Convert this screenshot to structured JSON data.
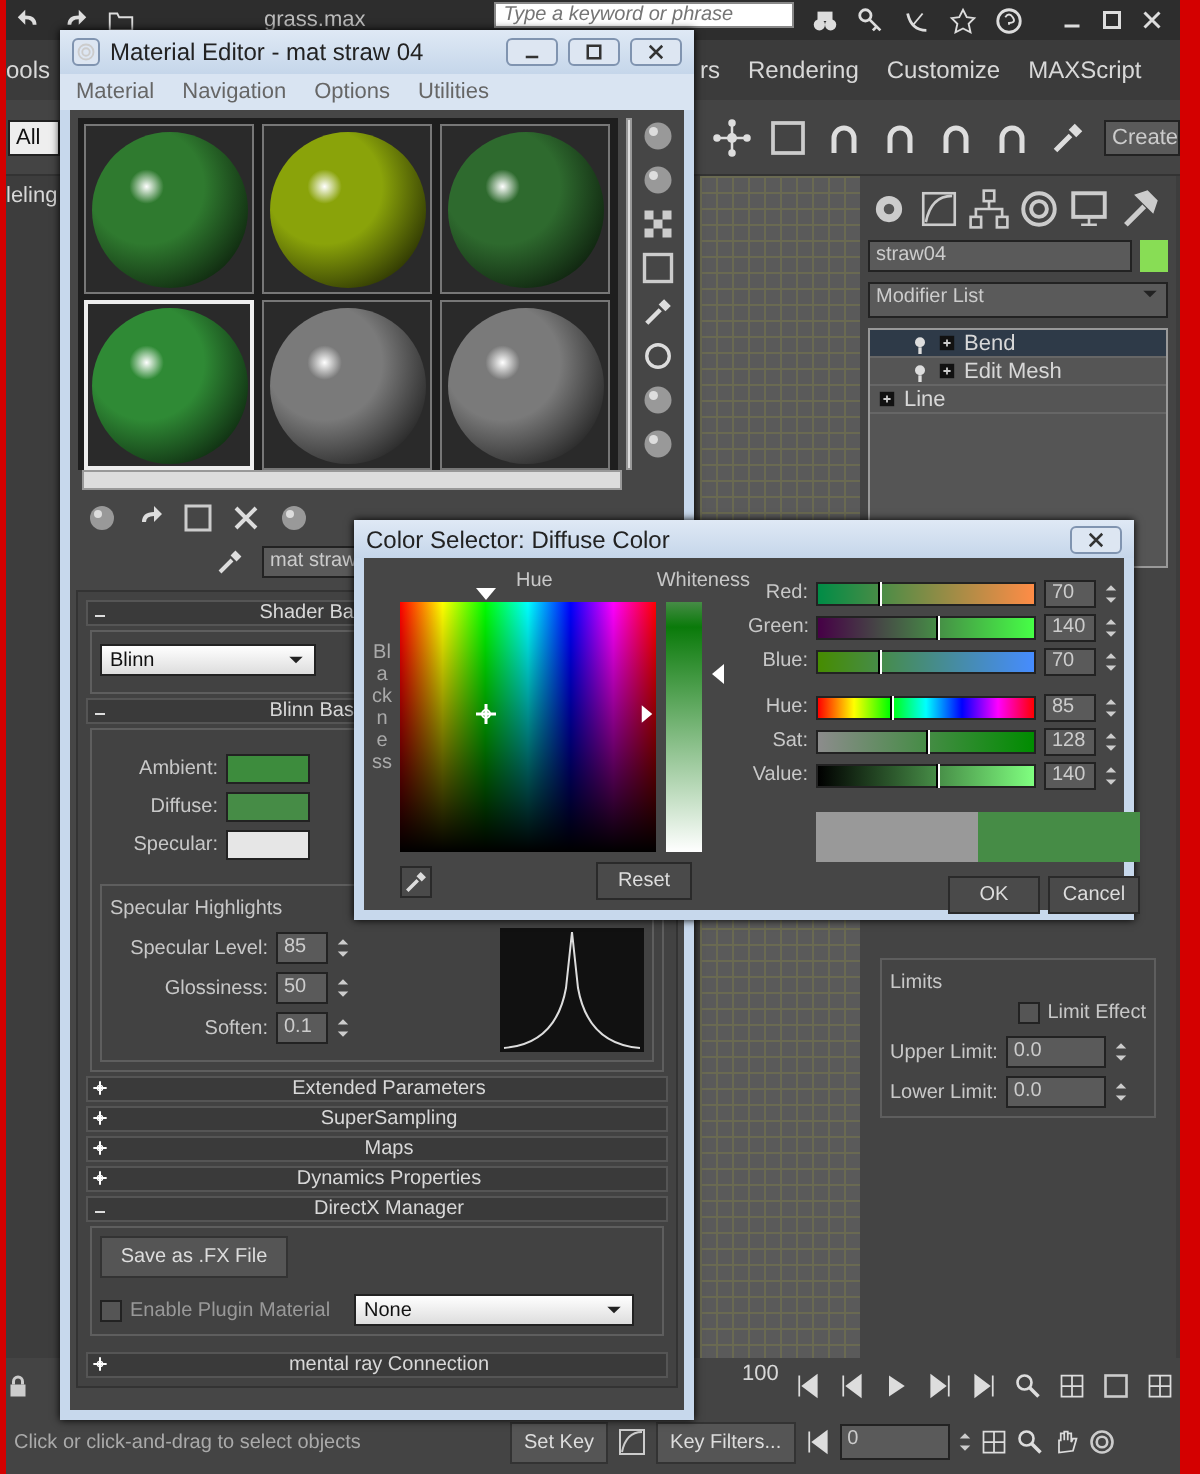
{
  "app": {
    "file_title": "grass.max",
    "search": {
      "placeholder": "Type a keyword or phrase"
    },
    "menus": [
      "ools",
      "rs",
      "Rendering",
      "Customize",
      "MAXScript"
    ],
    "selection_filter": "All",
    "named_selection": "Create",
    "viewport_label": "leling",
    "command_panel": {
      "object_name": "straw04",
      "modifier_list": "Modifier List",
      "stack": [
        {
          "label": "Bend",
          "kind": "modifier",
          "selected": true
        },
        {
          "label": "Edit Mesh",
          "kind": "modifier",
          "selected": false
        },
        {
          "label": "Line",
          "kind": "base",
          "selected": false
        }
      ],
      "limits": {
        "title": "Limits",
        "limit_effect": {
          "label": "Limit Effect",
          "checked": false
        },
        "fields": [
          {
            "label": "Upper Limit:",
            "value": "0.0"
          },
          {
            "label": "Lower Limit:",
            "value": "0.0"
          }
        ]
      }
    },
    "timeline_end": "100",
    "status": "Click or click-and-drag to select objects",
    "set_key": "Set Key",
    "key_filters": "Key Filters...",
    "frame": "0"
  },
  "material_editor": {
    "title": "Material Editor - mat straw 04",
    "menus": [
      "Material",
      "Navigation",
      "Options",
      "Utilities"
    ],
    "spheres": [
      {
        "color": "#2f7a2f",
        "selected": false
      },
      {
        "color": "#8aa30a",
        "selected": false
      },
      {
        "color": "#2e6a2e",
        "selected": false
      },
      {
        "color": "#2f8a35",
        "selected": true
      },
      {
        "color": "#7a7a7a",
        "selected": false
      },
      {
        "color": "#7a7a7a",
        "selected": false
      }
    ],
    "material_name": "mat straw",
    "shader_rollout": {
      "title": "Shader Ba",
      "shader": "Blinn"
    },
    "basic_rollout": {
      "title": "Blinn Bas",
      "colors": [
        {
          "label": "Ambient:",
          "color": "#3d8c3d"
        },
        {
          "label": "Diffuse:",
          "color": "#468c46"
        },
        {
          "label": "Specular:",
          "color": "#e6e6e6"
        }
      ]
    },
    "highlights": {
      "title": "Specular Highlights",
      "fields": [
        {
          "label": "Specular Level:",
          "value": "85"
        },
        {
          "label": "Glossiness:",
          "value": "50"
        },
        {
          "label": "Soften:",
          "value": "0.1"
        }
      ]
    },
    "rollouts": [
      {
        "title": "Extended Parameters",
        "expanded": false
      },
      {
        "title": "SuperSampling",
        "expanded": false
      },
      {
        "title": "Maps",
        "expanded": false
      },
      {
        "title": "Dynamics Properties",
        "expanded": false
      },
      {
        "title": "DirectX Manager",
        "expanded": true
      }
    ],
    "directx": {
      "save_button": "Save as .FX File",
      "plugin": {
        "label": "Enable Plugin Material",
        "checked": false
      },
      "plugin_choice": "None"
    },
    "last_rollout": {
      "title": "mental ray Connection",
      "expanded": false
    }
  },
  "color_selector": {
    "title": "Color Selector: Diffuse Color",
    "hue_label": "Hue",
    "whiteness_label": "Whiteness",
    "blackness_label": "Blackness",
    "channels": [
      {
        "label": "Red:",
        "kind": "red",
        "value": "70",
        "level": 0.275
      },
      {
        "label": "Green:",
        "kind": "green",
        "value": "140",
        "level": 0.549
      },
      {
        "label": "Blue:",
        "kind": "blue",
        "value": "70",
        "level": 0.275
      },
      {
        "label": "Hue:",
        "kind": "hue",
        "value": "85",
        "level": 0.333
      },
      {
        "label": "Sat:",
        "kind": "sat",
        "value": "128",
        "level": 0.502
      },
      {
        "label": "Value:",
        "kind": "value",
        "value": "140",
        "level": 0.549
      }
    ],
    "swatches": [
      {
        "color": "#999999"
      },
      {
        "color": "#468c46"
      }
    ],
    "reset": "Reset",
    "ok": "OK",
    "cancel": "Cancel"
  }
}
